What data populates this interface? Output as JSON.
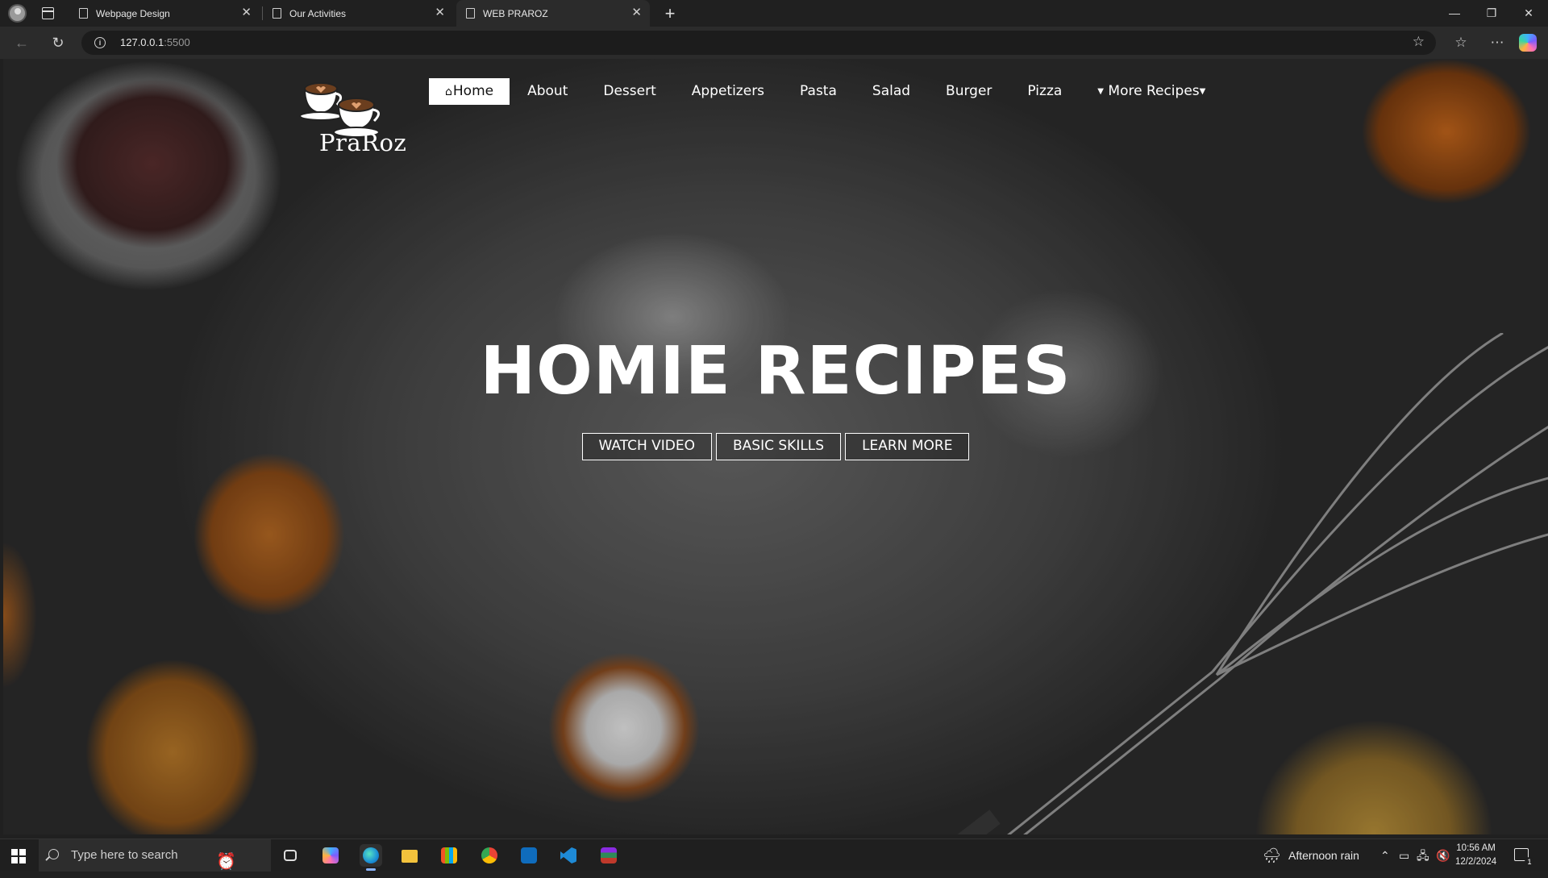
{
  "browser": {
    "tabs": [
      {
        "title": "Webpage Design"
      },
      {
        "title": "Our Activities"
      },
      {
        "title": "WEB PRAROZ"
      }
    ],
    "url_host": "127.0.0.1",
    "url_port": ":5500"
  },
  "site": {
    "logo_text": "PraRoz",
    "nav": [
      {
        "label": "Home",
        "icon": "home-icon",
        "active": true
      },
      {
        "label": "About"
      },
      {
        "label": "Dessert"
      },
      {
        "label": "Appetizers"
      },
      {
        "label": "Pasta"
      },
      {
        "label": "Salad"
      },
      {
        "label": "Burger"
      },
      {
        "label": "Pizza"
      },
      {
        "label": "More Recipes",
        "icon": "caret-down-icon"
      }
    ],
    "hero_title": "HOMIE RECIPES",
    "hero_buttons": [
      "WATCH VIDEO",
      "BASIC SKILLS",
      "LEARN MORE"
    ]
  },
  "taskbar": {
    "search_placeholder": "Type here to search",
    "weather": "Afternoon rain",
    "time": "10:56 AM",
    "date": "12/2/2024",
    "notification_count": "1"
  },
  "colors": {
    "chrome_bg": "#202020",
    "nav_active_bg": "#ffffff",
    "hero_text": "#ffffff"
  }
}
